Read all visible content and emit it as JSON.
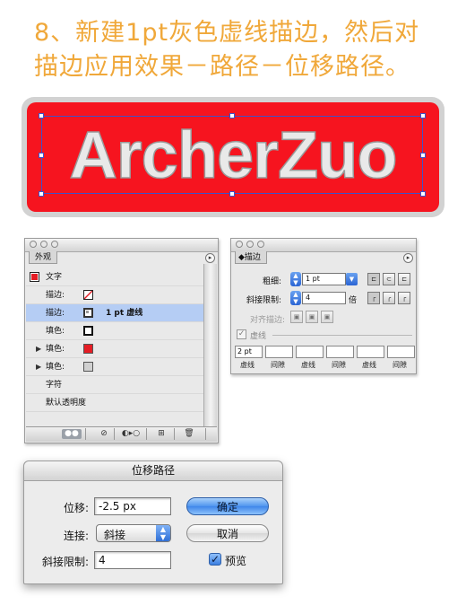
{
  "heading": {
    "line1": "8、新建1pt灰色虚线描边，然后对",
    "line2": "描边应用效果－路径－位移路径。"
  },
  "banner": {
    "text": "ArcherZuo",
    "bg_color": "#f6141f",
    "text_color": "#e9e9e9"
  },
  "appearance_panel": {
    "tab": "外观",
    "object_label": "文字",
    "rows": [
      {
        "label": "描边:",
        "value": ""
      },
      {
        "label": "描边:",
        "value": "1 pt 虚线"
      },
      {
        "label": "填色:",
        "value": ""
      },
      {
        "label": "填色:",
        "value": ""
      },
      {
        "label": "填色:",
        "value": ""
      },
      {
        "label": "字符",
        "value": ""
      },
      {
        "label": "默认透明度",
        "value": ""
      }
    ]
  },
  "stroke_panel": {
    "tab": "描边",
    "weight_label": "粗细:",
    "weight_value": "1 pt",
    "miter_label": "斜接限制:",
    "miter_value": "4",
    "miter_unit": "倍",
    "align_label": "对齐描边:",
    "dashed_label": "虚线",
    "dashed_checked": true,
    "dash_values": [
      "2 pt",
      "",
      "",
      "",
      "",
      ""
    ],
    "dash_headers": [
      "虚线",
      "间隙",
      "虚线",
      "间隙",
      "虚线",
      "间隙"
    ]
  },
  "offset_dialog": {
    "title": "位移路径",
    "offset_label": "位移:",
    "offset_value": "-2.5 px",
    "joins_label": "连接:",
    "joins_value": "斜接",
    "miter_label": "斜接限制:",
    "miter_value": "4",
    "ok_label": "确定",
    "cancel_label": "取消",
    "preview_label": "预览",
    "preview_checked": true
  }
}
